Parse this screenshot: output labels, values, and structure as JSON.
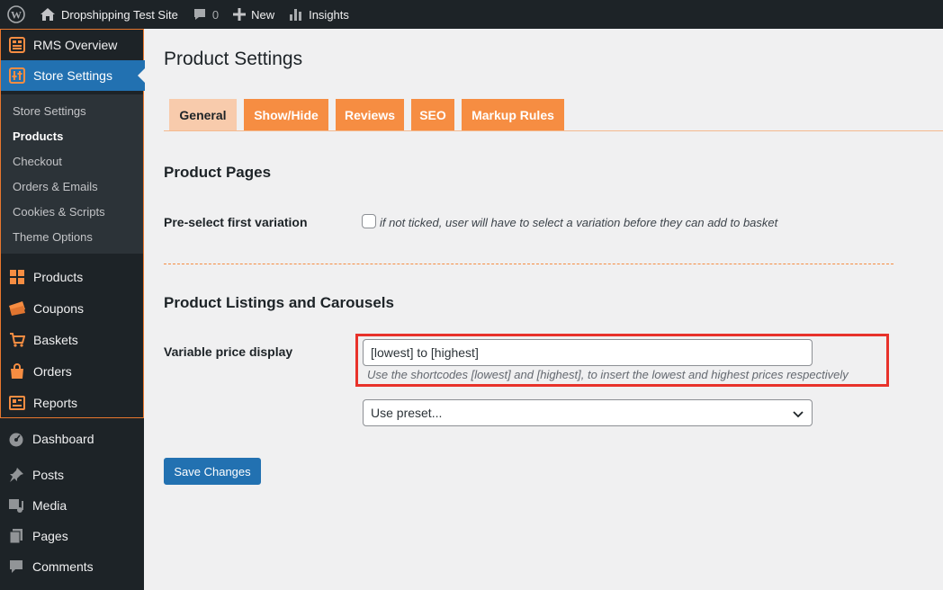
{
  "admin_bar": {
    "site_name": "Dropshipping Test Site",
    "comments_count": "0",
    "new_label": "New",
    "insights_label": "Insights"
  },
  "sidebar": {
    "rms_items": [
      {
        "label": "RMS Overview",
        "icon": "grid-icon"
      },
      {
        "label": "Store Settings",
        "icon": "settings-icon"
      }
    ],
    "submenu": [
      "Store Settings",
      "Products",
      "Checkout",
      "Orders & Emails",
      "Cookies & Scripts",
      "Theme Options"
    ],
    "submenu_current": "Products",
    "shop_items": [
      {
        "label": "Products",
        "icon": "products-icon"
      },
      {
        "label": "Coupons",
        "icon": "coupons-icon"
      },
      {
        "label": "Baskets",
        "icon": "cart-icon"
      },
      {
        "label": "Orders",
        "icon": "bag-icon"
      },
      {
        "label": "Reports",
        "icon": "reports-icon"
      }
    ],
    "wp_items": [
      {
        "label": "Dashboard",
        "icon": "dashboard-icon"
      },
      {
        "label": "Posts",
        "icon": "pin-icon"
      },
      {
        "label": "Media",
        "icon": "media-icon"
      },
      {
        "label": "Pages",
        "icon": "pages-icon"
      },
      {
        "label": "Comments",
        "icon": "comment-icon"
      }
    ]
  },
  "main": {
    "title": "Product Settings",
    "tabs": [
      "General",
      "Show/Hide",
      "Reviews",
      "SEO",
      "Markup Rules"
    ],
    "active_tab": "General",
    "product_pages": {
      "heading": "Product Pages",
      "preselect_label": "Pre-select first variation",
      "preselect_checked": false,
      "preselect_desc": "if not ticked, user will have to select a variation before they can add to basket"
    },
    "listings": {
      "heading": "Product Listings and Carousels",
      "price_label": "Variable price display",
      "price_value": "[lowest] to [highest]",
      "price_desc": "Use the shortcodes [lowest] and [highest], to insert the lowest and highest prices respectively",
      "preset_value": "Use preset..."
    },
    "save_label": "Save Changes"
  },
  "colors": {
    "accent_orange": "#f68d42",
    "active_tab": "#f8cbac",
    "wp_blue": "#2271b1",
    "highlight_red": "#e8322b",
    "admin_dark": "#1d2327"
  }
}
